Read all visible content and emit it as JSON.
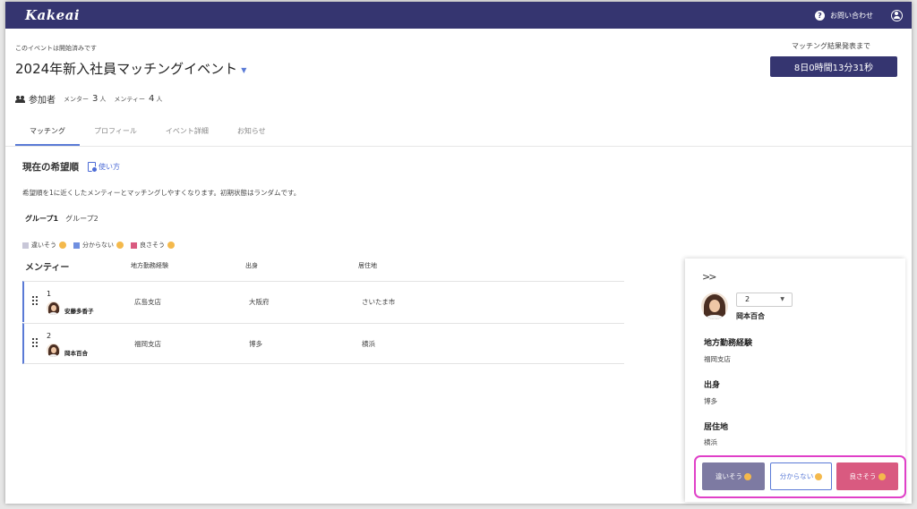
{
  "app": {
    "logo": "Kakeai"
  },
  "header": {
    "help_label": "お問い合わせ"
  },
  "event": {
    "status": "このイベントは開始済みです",
    "title": "2024年新入社員マッチングイベント",
    "participants_label": "参加者",
    "mentor_label": "メンター",
    "mentor_count": "3",
    "mentee_label": "メンティー",
    "mentee_count": "4",
    "unit": "人"
  },
  "countdown": {
    "label": "マッチング結果発表まで",
    "value": "8日0時間13分31秒"
  },
  "tabs": [
    {
      "label": "マッチング",
      "active": true
    },
    {
      "label": "プロフィール",
      "active": false
    },
    {
      "label": "イベント詳細",
      "active": false
    },
    {
      "label": "お知らせ",
      "active": false
    }
  ],
  "section": {
    "title": "現在の希望順",
    "howto": "使い方",
    "description": "希望順を1に近くしたメンティーとマッチングしやすくなります。初期状態はランダムです。"
  },
  "groups": [
    "グループ1",
    "グループ2"
  ],
  "legend": [
    {
      "label": "違いそう",
      "color": "#c8c7d8"
    },
    {
      "label": "分からない",
      "color": "#6f8fe0"
    },
    {
      "label": "良さそう",
      "color": "#d95a80"
    }
  ],
  "table": {
    "headers": [
      "メンティー",
      "地方勤務経験",
      "出身",
      "居住地"
    ],
    "rows": [
      {
        "rank": "1",
        "name": "安藤多香子",
        "experience": "広島支店",
        "origin": "大阪府",
        "residence": "さいたま市"
      },
      {
        "rank": "2",
        "name": "岡本百合",
        "experience": "福岡支店",
        "origin": "博多",
        "residence": "横浜"
      }
    ]
  },
  "panel": {
    "collapse": ">>",
    "rank": "2",
    "name": "岡本百合",
    "fields": [
      {
        "label": "地方勤務経験",
        "value": "福岡支店"
      },
      {
        "label": "出身",
        "value": "博多"
      },
      {
        "label": "居住地",
        "value": "横浜"
      }
    ],
    "buttons": {
      "bad": "違いそう",
      "unknown": "分からない",
      "good": "良さそう"
    }
  }
}
